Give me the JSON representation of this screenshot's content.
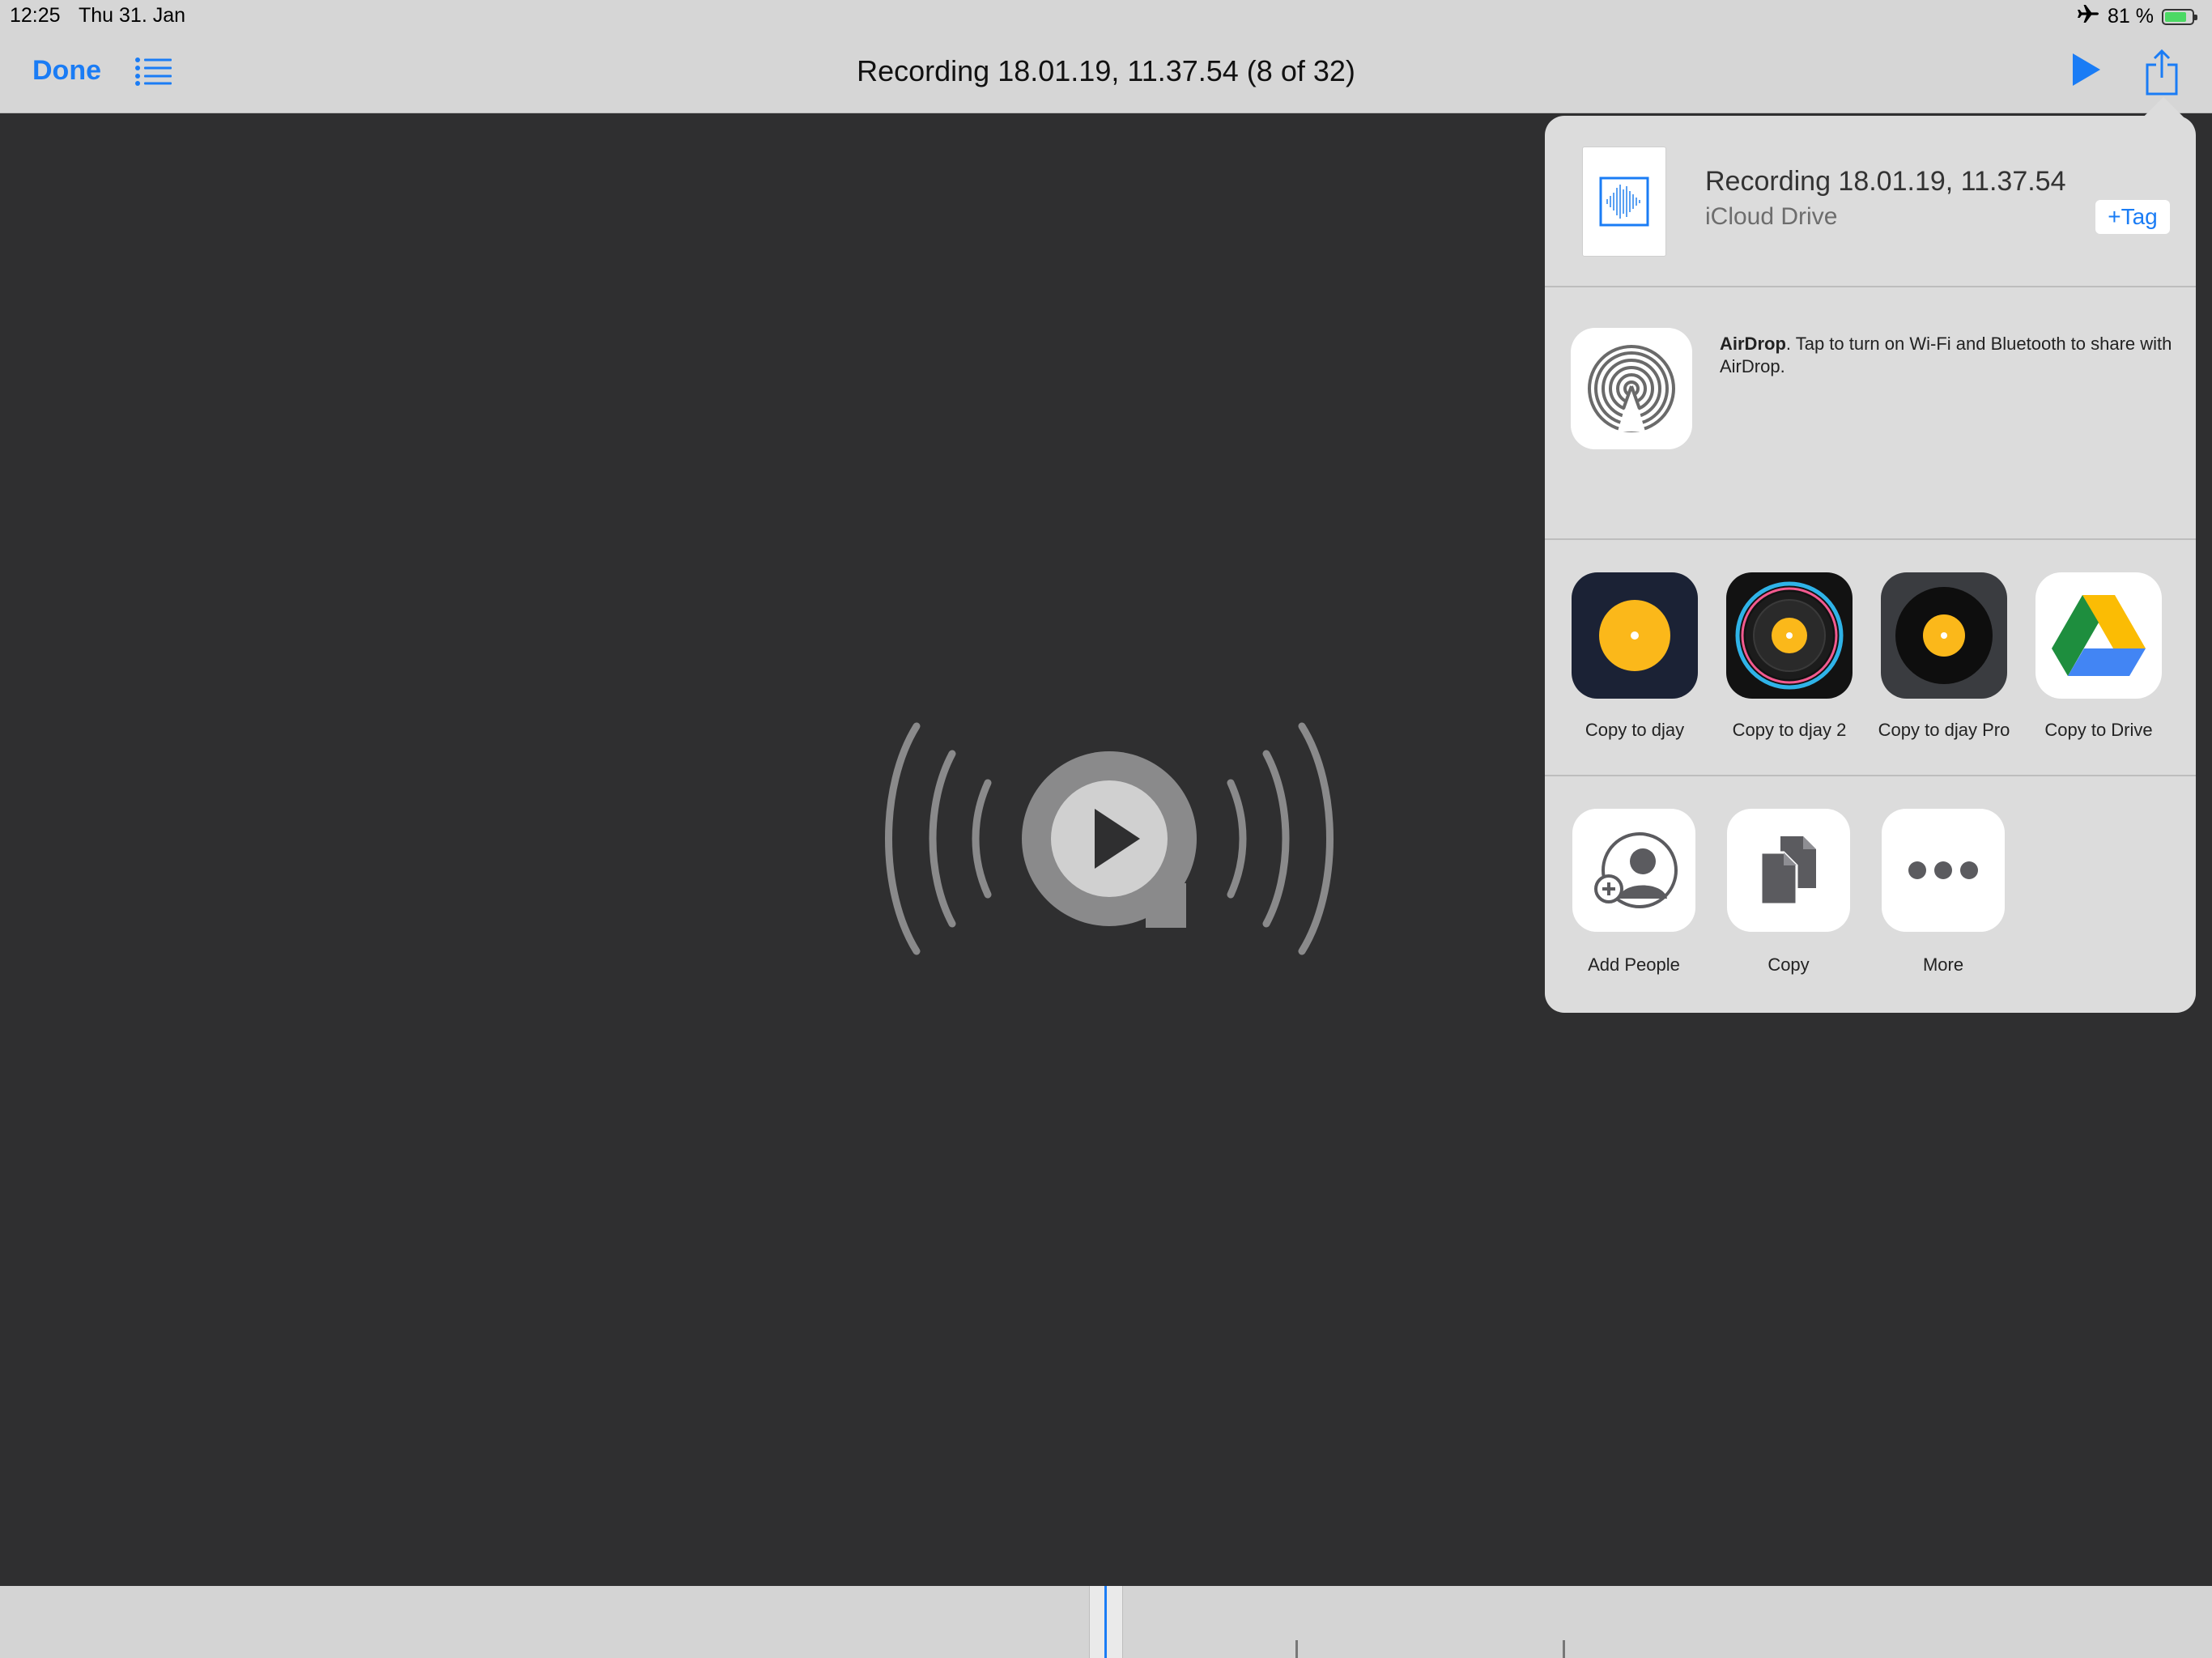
{
  "status_bar": {
    "time": "12:25",
    "date": "Thu 31. Jan",
    "battery_text": "81 %",
    "battery_level": 0.81,
    "icons": [
      "airplane-icon",
      "battery-icon"
    ]
  },
  "nav": {
    "done_label": "Done",
    "title": "Recording 18.01.19, 11.37.54 (8 of 32)",
    "icons": [
      "list-icon",
      "play-icon",
      "share-icon"
    ]
  },
  "player": {
    "logo": "quicktime-audio-icon"
  },
  "share_sheet": {
    "file": {
      "name": "Recording 18.01.19, 11.37.54",
      "location": "iCloud Drive",
      "tag_label": "+Tag"
    },
    "airdrop": {
      "title": "AirDrop",
      "text": ". Tap to turn on Wi-Fi and Bluetooth to share with AirDrop."
    },
    "apps": [
      {
        "label": "Copy to djay",
        "icon": "djay-icon"
      },
      {
        "label": "Copy to djay 2",
        "icon": "djay2-icon"
      },
      {
        "label": "Copy to djay Pro",
        "icon": "djay-pro-icon"
      },
      {
        "label": "Copy to Drive",
        "icon": "google-drive-icon"
      }
    ],
    "actions": [
      {
        "label": "Add People",
        "icon": "add-people-icon"
      },
      {
        "label": "Copy",
        "icon": "copy-icon"
      },
      {
        "label": "More",
        "icon": "more-icon"
      }
    ]
  },
  "colors": {
    "accent": "#1a7cf5",
    "background": "#2f2f30",
    "bar": "#d6d6d6",
    "sheet": "#dcdcdc"
  }
}
